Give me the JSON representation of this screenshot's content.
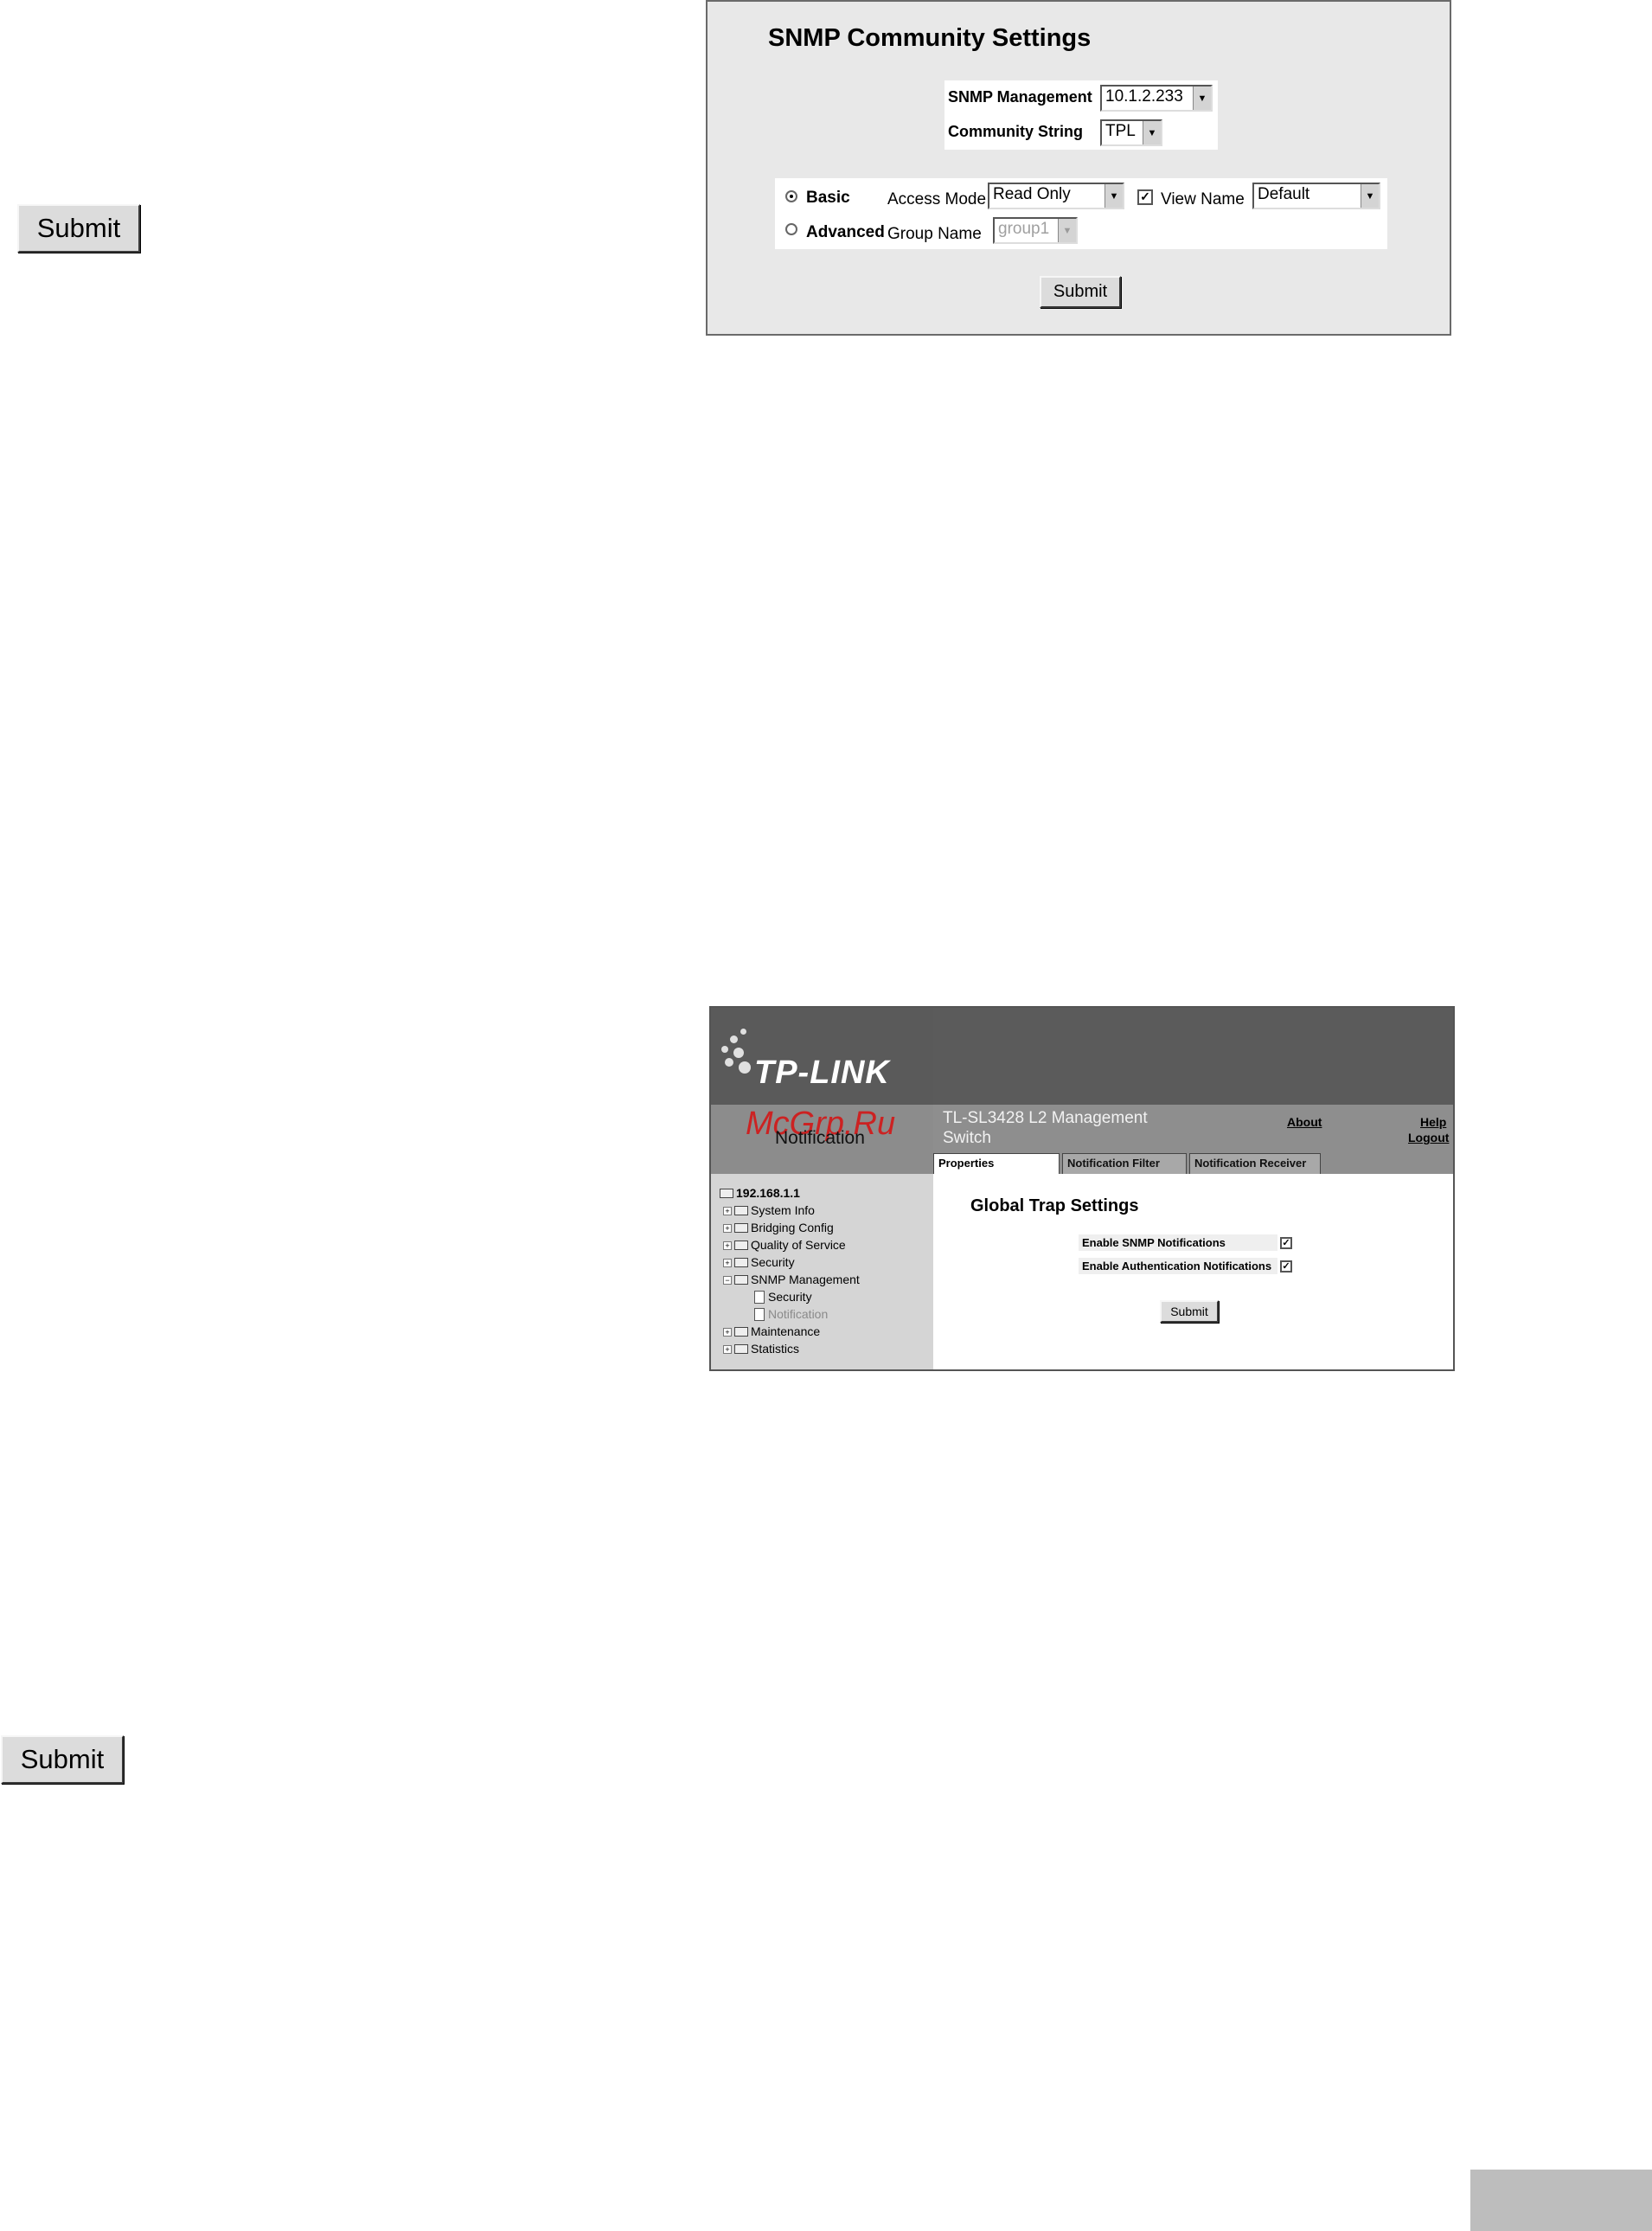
{
  "left_buttons": {
    "top_submit": "Submit",
    "bottom_submit": "Submit"
  },
  "snmp_dialog": {
    "title": "SNMP Community Settings",
    "snmp_management_label": "SNMP Management",
    "snmp_management_value": "10.1.2.233",
    "community_string_label": "Community String",
    "community_string_value": "TPL",
    "basic_label": "Basic",
    "basic_selected": true,
    "access_mode_label": "Access Mode",
    "access_mode_value": "Read Only",
    "view_name_checked": true,
    "view_name_label": "View Name",
    "view_name_value": "Default",
    "advanced_label": "Advanced",
    "group_name_label": "Group Name",
    "group_name_value": "group1",
    "submit_label": "Submit"
  },
  "tplink_ui": {
    "logo": "TP-LINK",
    "watermark": "McGrp.Ru",
    "page_name": "Notification",
    "model": "TL-SL3428 L2 Management Switch",
    "links": {
      "about": "About",
      "help": "Help",
      "logout": "Logout"
    },
    "tabs": [
      {
        "label": "Properties",
        "active": true
      },
      {
        "label": "Notification Filter",
        "active": false
      },
      {
        "label": "Notification Receiver",
        "active": false
      }
    ],
    "tree": {
      "root": "192.168.1.1",
      "items": [
        "System Info",
        "Bridging Config",
        "Quality of Service",
        "Security",
        "SNMP Management",
        "Security",
        "Notification",
        "Maintenance",
        "Statistics"
      ]
    },
    "main": {
      "title": "Global Trap Settings",
      "enable_snmp_label": "Enable SNMP Notifications",
      "enable_snmp_checked": true,
      "enable_auth_label": "Enable Authentication Notifications",
      "enable_auth_checked": true,
      "submit_label": "Submit"
    }
  },
  "colors": {
    "panel_bg": "#e8e8e8",
    "header_dark": "#5b5b5b",
    "subbar": "#8e8e8e",
    "sidebar": "#d5d5d5",
    "watermark_red": "#cc2222",
    "corner_tab": "#bdbdbd"
  }
}
